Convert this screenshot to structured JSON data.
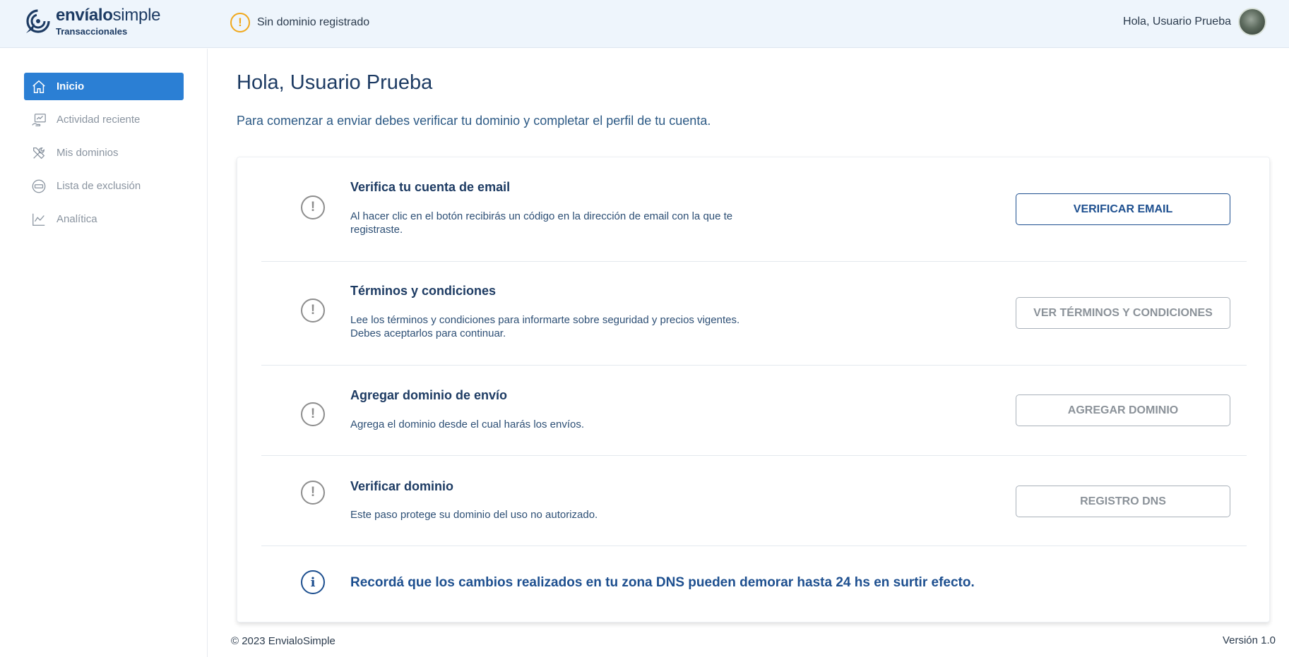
{
  "header": {
    "brand_bold": "envíalo",
    "brand_light": "simple",
    "brand_sub": "Transaccionales",
    "domain_warning": "Sin dominio registrado",
    "greeting": "Hola, Usuario Prueba"
  },
  "sidebar": {
    "items": [
      {
        "label": "Inicio",
        "icon": "home-icon",
        "active": true
      },
      {
        "label": "Actividad reciente",
        "icon": "activity-icon",
        "active": false
      },
      {
        "label": "Mis dominios",
        "icon": "tools-icon",
        "active": false
      },
      {
        "label": "Lista de exclusión",
        "icon": "blocked-icon",
        "active": false
      },
      {
        "label": "Analítica",
        "icon": "chart-line-icon",
        "active": false
      }
    ]
  },
  "main": {
    "title": "Hola, Usuario Prueba",
    "subtitle": "Para comenzar a enviar debes verificar tu dominio y completar el perfil de tu cuenta.",
    "steps": [
      {
        "title": "Verifica tu cuenta de email",
        "description": "Al hacer clic en el botón recibirás un código en la dirección de email con la que te registraste.",
        "button": "VERIFICAR EMAIL"
      },
      {
        "title": "Términos y condiciones",
        "description": "Lee los términos y condiciones para informarte sobre seguridad y precios vigentes. Debes aceptarlos para continuar.",
        "button": "VER TÉRMINOS Y CONDICIONES"
      },
      {
        "title": "Agregar dominio de envío",
        "description": "Agrega el dominio desde el cual harás los envíos.",
        "button": "AGREGAR DOMINIO"
      },
      {
        "title": "Verificar dominio",
        "description": "Este paso protege su dominio del uso no autorizado.",
        "button": "REGISTRO DNS"
      }
    ],
    "info": "Recordá que los cambios realizados en tu zona DNS pueden demorar hasta 24 hs en surtir efecto.",
    "step_icon_glyph": "!",
    "info_icon_glyph": "i"
  },
  "footer": {
    "copyright": "© 2023 EnvialoSimple",
    "version": "Versión 1.0"
  },
  "colors": {
    "accent": "#2b7fd4",
    "brand_dark": "#1d3b63",
    "warning": "#f0a81c",
    "primary_button": "#1d4f8f"
  }
}
